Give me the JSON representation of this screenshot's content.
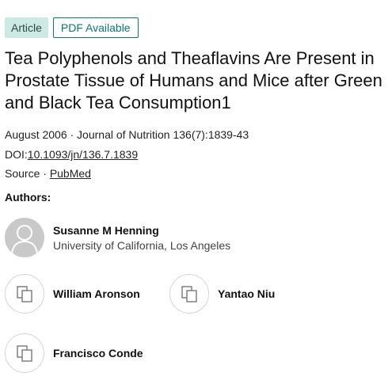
{
  "badges": {
    "type": "Article",
    "pdf": "PDF Available"
  },
  "publication": {
    "title": "Tea Polyphenols and Theaflavins Are Present in Prostate Tissue of Humans and Mice after Green and Black Tea Consumption1",
    "date_journal": "August 2006 · Journal of Nutrition 136(7):1839-43",
    "doi_label": "DOI:",
    "doi": "10.1093/jn/136.7.1839",
    "source_label": "Source · ",
    "source": "PubMed"
  },
  "authors_label": "Authors:",
  "authors": [
    {
      "name": "Susanne M Henning",
      "affiliation": "University of California, Los Angeles",
      "avatar": "user-silhouette-icon"
    },
    {
      "name": "William Aronson",
      "avatar": "placeholder-pages-icon"
    },
    {
      "name": "Yantao Niu",
      "avatar": "placeholder-pages-icon"
    },
    {
      "name": "Francisco Conde",
      "avatar": "placeholder-pages-icon"
    }
  ],
  "colors": {
    "accent": "#0b7868",
    "badge_bg": "#cde9e4"
  }
}
